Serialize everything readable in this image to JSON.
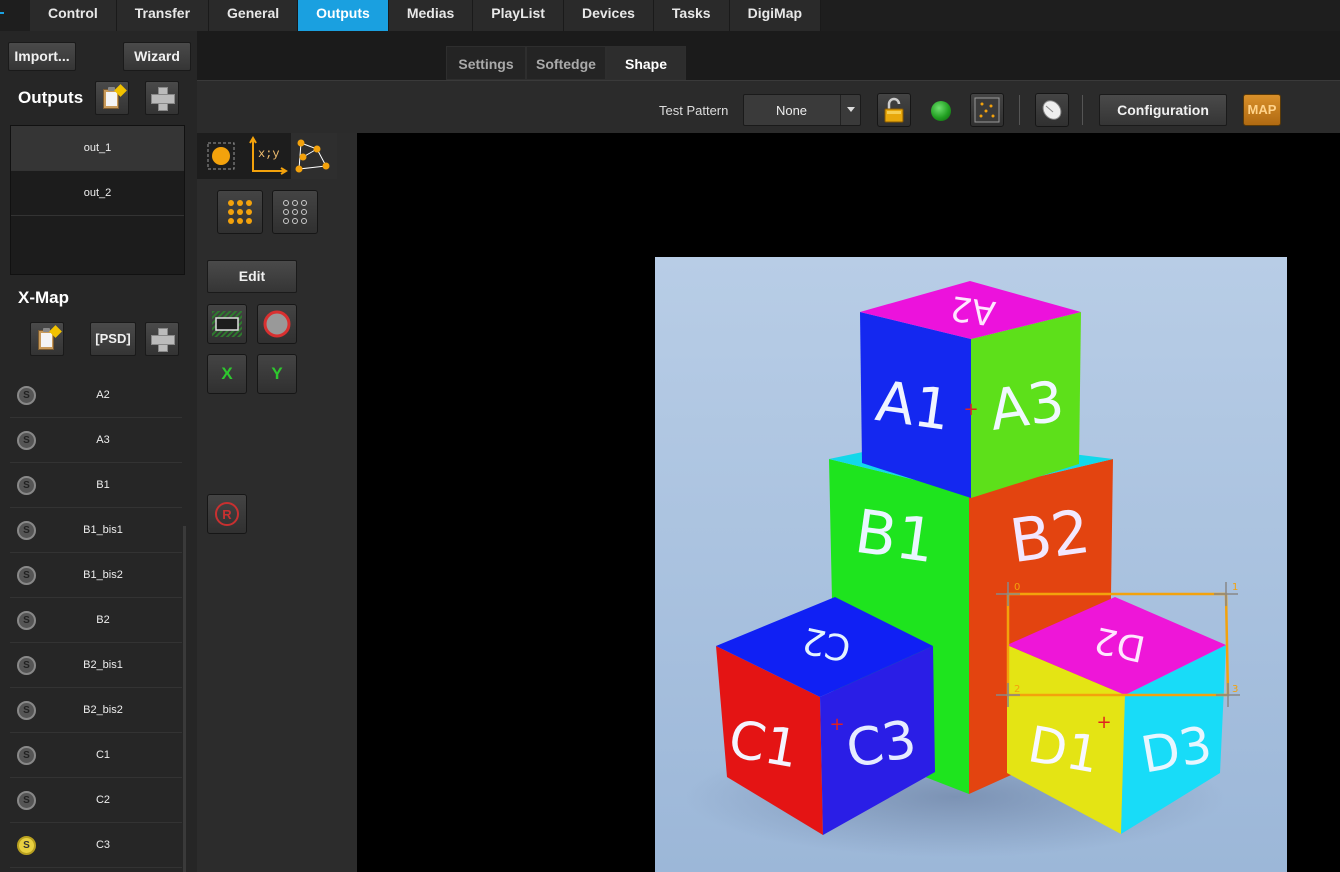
{
  "top_nav": {
    "tabs": [
      "Control",
      "Transfer",
      "General",
      "Outputs",
      "Medias",
      "PlayList",
      "Devices",
      "Tasks",
      "DigiMap"
    ],
    "active": "Outputs",
    "accent_color": "#1aa0e0"
  },
  "left_panel": {
    "import_label": "Import...",
    "wizard_label": "Wizard",
    "outputs_title": "Outputs",
    "outputs": [
      "out_1",
      "out_2"
    ],
    "selected_output": "out_1",
    "xmap_title": "X-Map",
    "psd_label": "[PSD]",
    "xmap_items": [
      {
        "label": "A2",
        "badge": "S",
        "active": false
      },
      {
        "label": "A3",
        "badge": "S",
        "active": false
      },
      {
        "label": "B1",
        "badge": "S",
        "active": false
      },
      {
        "label": "B1_bis1",
        "badge": "S",
        "active": false
      },
      {
        "label": "B1_bis2",
        "badge": "S",
        "active": false
      },
      {
        "label": "B2",
        "badge": "S",
        "active": false
      },
      {
        "label": "B2_bis1",
        "badge": "S",
        "active": false
      },
      {
        "label": "B2_bis2",
        "badge": "S",
        "active": false
      },
      {
        "label": "C1",
        "badge": "S",
        "active": false
      },
      {
        "label": "C2",
        "badge": "S",
        "active": false
      },
      {
        "label": "C3",
        "badge": "S",
        "active": true
      }
    ]
  },
  "sub_tabs": {
    "items": [
      "Settings",
      "Softedge",
      "Shape"
    ],
    "active": "Shape"
  },
  "toolbar": {
    "test_pattern_label": "Test Pattern",
    "test_pattern_value": "None",
    "configuration_label": "Configuration",
    "map_label": "MAP",
    "status_color": "#22a022"
  },
  "tools": {
    "xy_label": "x;y",
    "edit_label": "Edit",
    "x_label": "X",
    "y_label": "Y",
    "reset_label": "R"
  },
  "preview": {
    "faces": {
      "a_left": "A1",
      "a_top": "A2",
      "a_right": "A3",
      "b_left": "B1",
      "b_right": "B2",
      "c_left": "C1",
      "c_top": "C2",
      "c_right": "C3",
      "d_left": "D1",
      "d_top": "D2",
      "d_right": "D3"
    },
    "handles": [
      "0",
      "1",
      "2",
      "3"
    ]
  }
}
